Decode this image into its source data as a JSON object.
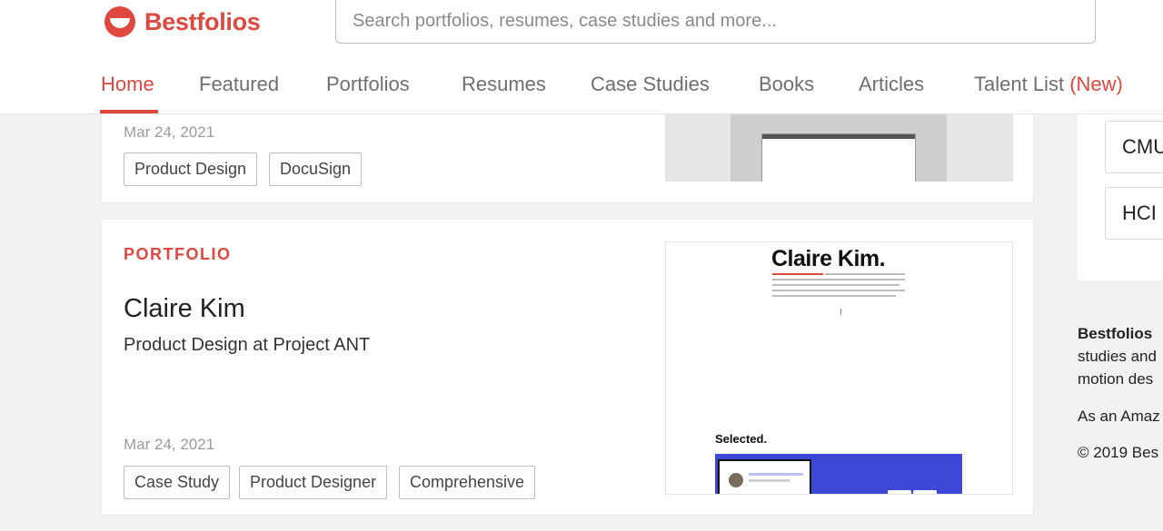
{
  "header": {
    "brand": "Bestfolios",
    "search_placeholder": "Search portfolios, resumes, case studies and more...",
    "accent_color": "#e0473f"
  },
  "nav": {
    "items": [
      "Home",
      "Featured",
      "Portfolios",
      "Resumes",
      "Case Studies",
      "Books",
      "Articles",
      "Talent List"
    ],
    "new_badge": "(New)",
    "active": "Home"
  },
  "cards": [
    {
      "date": "Mar 24, 2021",
      "tags": [
        "Product Design",
        "DocuSign"
      ]
    },
    {
      "kind": "PORTFOLIO",
      "title": "Claire Kim",
      "subtitle": "Product Design at Project ANT",
      "date": "Mar 24, 2021",
      "tags": [
        "Case Study",
        "Product Designer",
        "Comprehensive"
      ],
      "thumbnail": {
        "heading": "Claire Kim.",
        "section_label": "Selected."
      }
    }
  ],
  "sidebar": {
    "chips": [
      "CMU",
      "HCI"
    ],
    "about_brand": "Bestfolios",
    "about_line_1": "studies and",
    "about_line_2": "motion des",
    "about_line_3": "As an Amaz",
    "copyright": "© 2019 Bes"
  }
}
